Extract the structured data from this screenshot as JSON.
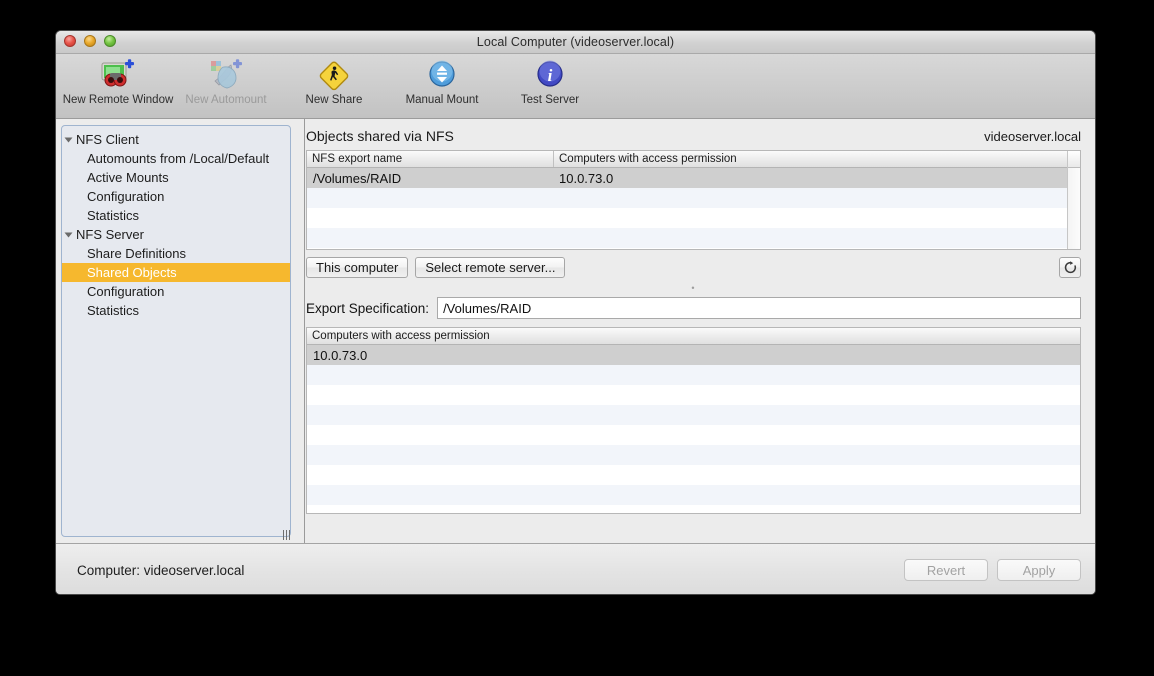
{
  "window": {
    "title": "Local Computer (videoserver.local)",
    "controls": {
      "close": "close-button",
      "minimize": "minimize-button",
      "maximize": "maximize-button"
    }
  },
  "toolbar": {
    "items": [
      {
        "label": "New Remote Window",
        "icon": "new-remote-window-icon",
        "disabled": false
      },
      {
        "label": "New Automount",
        "icon": "new-automount-icon",
        "disabled": true
      },
      {
        "label": "New Share",
        "icon": "new-share-icon",
        "disabled": false
      },
      {
        "label": "Manual Mount",
        "icon": "manual-mount-icon",
        "disabled": false
      },
      {
        "label": "Test Server",
        "icon": "test-server-icon",
        "disabled": false
      }
    ]
  },
  "sidebar": {
    "items": [
      {
        "label": "NFS Client",
        "type": "group",
        "expanded": true,
        "selected": false
      },
      {
        "label": "Automounts from /Local/Default",
        "type": "child",
        "selected": false
      },
      {
        "label": "Active Mounts",
        "type": "child",
        "selected": false
      },
      {
        "label": "Configuration",
        "type": "child",
        "selected": false
      },
      {
        "label": "Statistics",
        "type": "child",
        "selected": false
      },
      {
        "label": "NFS Server",
        "type": "group",
        "expanded": true,
        "selected": false
      },
      {
        "label": "Share Definitions",
        "type": "child",
        "selected": false
      },
      {
        "label": "Shared Objects",
        "type": "child",
        "selected": true
      },
      {
        "label": "Configuration",
        "type": "child",
        "selected": false
      },
      {
        "label": "Statistics",
        "type": "child",
        "selected": false
      }
    ],
    "selection_color": "#f6b82e"
  },
  "main": {
    "title": "Objects shared via NFS",
    "host": "videoserver.local",
    "shares_table": {
      "columns": [
        "NFS export name",
        "Computers with access permission"
      ],
      "rows": [
        {
          "export": "/Volumes/RAID",
          "computers": "10.0.73.0",
          "selected": true
        }
      ],
      "empty_rows": 4
    },
    "buttons": {
      "this_computer": "This computer",
      "select_remote_server": "Select remote server...",
      "refresh_icon": "refresh-icon"
    },
    "export_spec": {
      "label": "Export Specification:",
      "value": "/Volumes/RAID"
    },
    "access_table": {
      "columns": [
        "Computers with access permission"
      ],
      "rows": [
        {
          "computer": "10.0.73.0",
          "selected": true
        }
      ],
      "empty_rows": 8
    }
  },
  "bottom": {
    "status": "Computer: videoserver.local",
    "revert_label": "Revert",
    "apply_label": "Apply",
    "buttons_enabled": false
  }
}
